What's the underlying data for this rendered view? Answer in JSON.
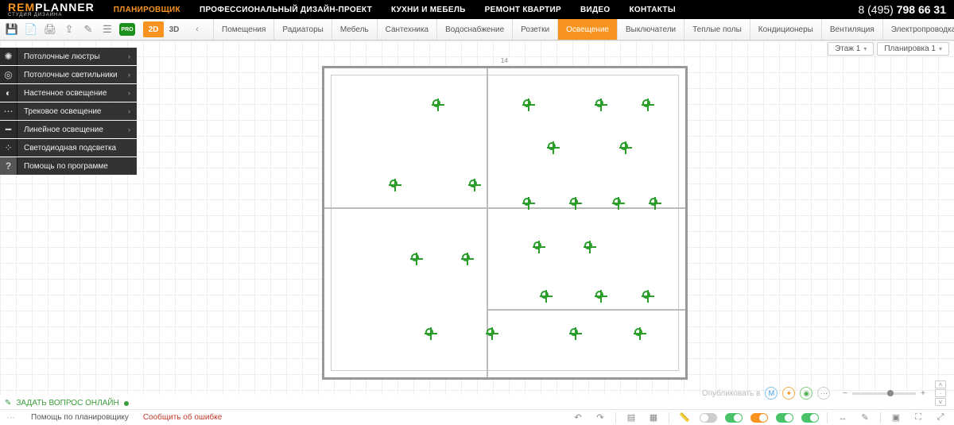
{
  "brand": {
    "rem": "REM",
    "planner": "PLANNER",
    "sub": "СТУДИЯ ДИЗАЙНА"
  },
  "phone": {
    "prefix": "8 (495) ",
    "main": "798 66 31"
  },
  "topmenu": [
    {
      "label": "ПЛАНИРОВЩИК",
      "active": true
    },
    {
      "label": "ПРОФЕССИОНАЛЬНЫЙ ДИЗАЙН-ПРОЕКТ"
    },
    {
      "label": "КУХНИ И МЕБЕЛЬ"
    },
    {
      "label": "РЕМОНТ КВАРТИР"
    },
    {
      "label": "ВИДЕО"
    },
    {
      "label": "КОНТАКТЫ"
    }
  ],
  "toolbar": {
    "pro": "PRO",
    "view2d": "2D",
    "view3d": "3D",
    "chev_left": "‹",
    "chev_right": "›"
  },
  "categories": [
    {
      "label": "Помещения"
    },
    {
      "label": "Радиаторы"
    },
    {
      "label": "Мебель"
    },
    {
      "label": "Сантехника"
    },
    {
      "label": "Водоснабжение"
    },
    {
      "label": "Розетки"
    },
    {
      "label": "Освещение",
      "active": true
    },
    {
      "label": "Выключатели"
    },
    {
      "label": "Теплые полы"
    },
    {
      "label": "Кондиционеры"
    },
    {
      "label": "Вентиляция"
    },
    {
      "label": "Электропроводка"
    }
  ],
  "pills": {
    "floor": "Этаж 1",
    "layout": "Планировка 1"
  },
  "side_panel": [
    {
      "label": "Потолочные люстры",
      "arrow": true
    },
    {
      "label": "Потолочные светильники",
      "arrow": true
    },
    {
      "label": "Настенное освещение",
      "arrow": true
    },
    {
      "label": "Трековое освещение",
      "arrow": true
    },
    {
      "label": "Линейное освещение",
      "arrow": true
    },
    {
      "label": "Светодиодная подсветка",
      "arrow": false
    },
    {
      "label": "Помощь по программе",
      "arrow": false
    }
  ],
  "ask_online": "ЗАДАТЬ ВОПРОС ОНЛАЙН",
  "publish_label": "Опубликовать в",
  "footer": {
    "help": "Помощь по планировщику",
    "bug": "Сообщить об ошибке"
  },
  "arrow_char": "›",
  "dropdown_char": "▾",
  "plan_labels": {
    "top": "14"
  }
}
